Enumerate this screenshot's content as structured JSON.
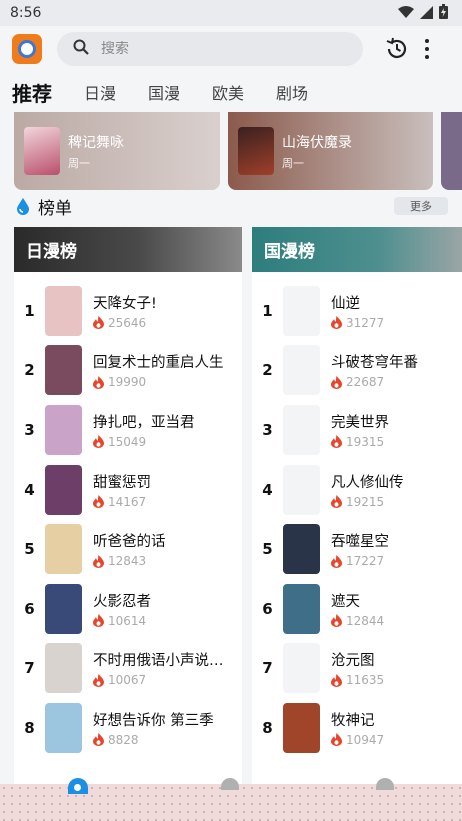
{
  "status": {
    "time": "8:56"
  },
  "header": {
    "search_placeholder": "搜索"
  },
  "tabs": [
    {
      "label": "推荐",
      "active": true
    },
    {
      "label": "日漫"
    },
    {
      "label": "国漫"
    },
    {
      "label": "欧美"
    },
    {
      "label": "剧场"
    }
  ],
  "banners": [
    {
      "name": "稗记舞咏",
      "day": "周一"
    },
    {
      "name": "山海伏魔录",
      "day": "周一"
    }
  ],
  "ranking": {
    "title": "榜单",
    "more": "更多",
    "japan": {
      "title": "日漫榜",
      "items": [
        {
          "rank": "1",
          "title": "天降女子!",
          "count": "25646",
          "color": "#e8c3c3"
        },
        {
          "rank": "2",
          "title": "回复术士的重启人生",
          "count": "19990",
          "color": "#7a4b5e"
        },
        {
          "rank": "3",
          "title": "挣扎吧，亚当君",
          "count": "15049",
          "color": "#c9a3c8"
        },
        {
          "rank": "4",
          "title": "甜蜜惩罚",
          "count": "14167",
          "color": "#6d3e68"
        },
        {
          "rank": "5",
          "title": "听爸爸的话",
          "count": "12843",
          "color": "#e7cfa4"
        },
        {
          "rank": "6",
          "title": "火影忍者",
          "count": "10614",
          "color": "#3a4a78"
        },
        {
          "rank": "7",
          "title": "不时用俄语小声说真心话的邻桌艾莉同学",
          "count": "10067",
          "color": "#d8d3cf"
        },
        {
          "rank": "8",
          "title": "好想告诉你 第三季",
          "count": "8828",
          "color": "#9cc6df"
        }
      ]
    },
    "china": {
      "title": "国漫榜",
      "items": [
        {
          "rank": "1",
          "title": "仙逆",
          "count": "31277",
          "color": "#f3f4f6"
        },
        {
          "rank": "2",
          "title": "斗破苍穹年番",
          "count": "22687",
          "color": "#f3f4f6"
        },
        {
          "rank": "3",
          "title": "完美世界",
          "count": "19315",
          "color": "#f3f4f6"
        },
        {
          "rank": "4",
          "title": "凡人修仙传",
          "count": "19215",
          "color": "#f3f4f6"
        },
        {
          "rank": "5",
          "title": "吞噬星空",
          "count": "17227",
          "color": "#2a3448"
        },
        {
          "rank": "6",
          "title": "遮天",
          "count": "12844",
          "color": "#3f6f88"
        },
        {
          "rank": "7",
          "title": "沧元图",
          "count": "11635",
          "color": "#f3f4f6"
        },
        {
          "rank": "8",
          "title": "牧神记",
          "count": "10947",
          "color": "#a0442a"
        }
      ]
    }
  }
}
